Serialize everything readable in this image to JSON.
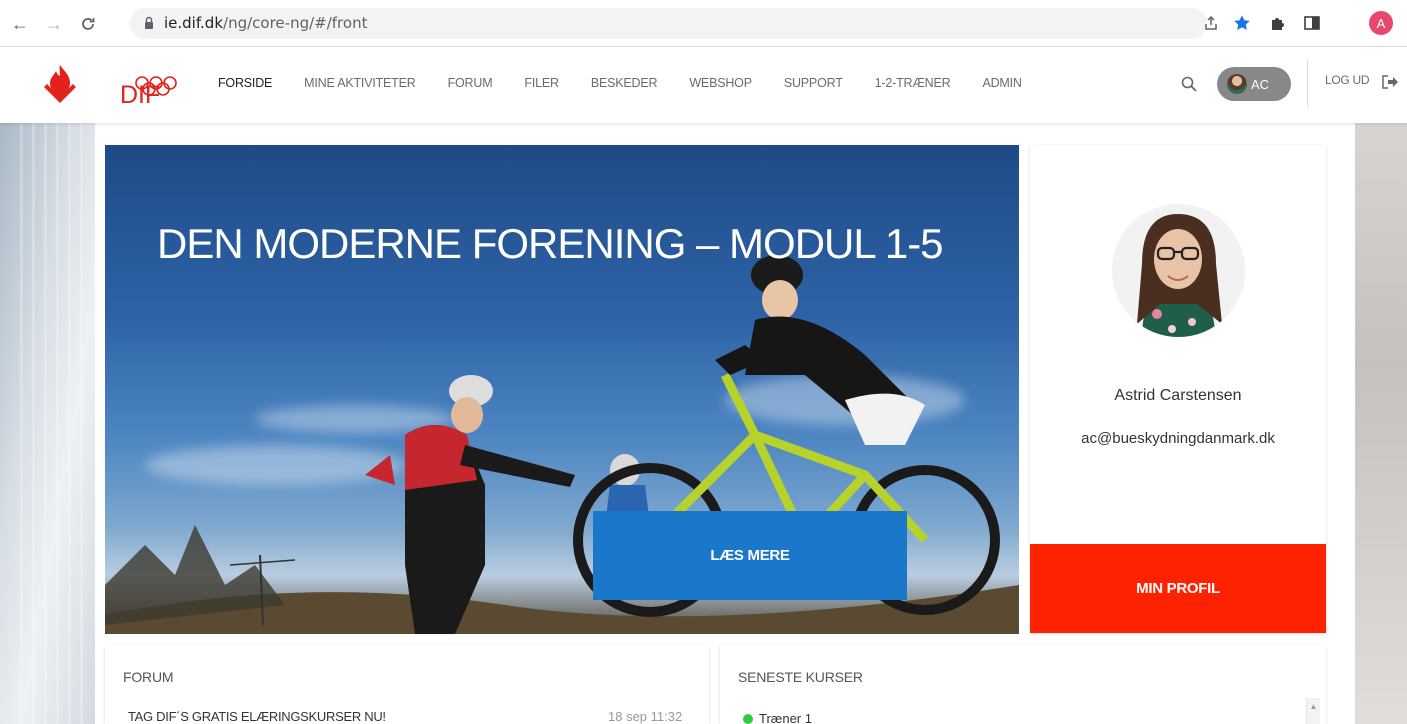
{
  "browser": {
    "url_domain": "ie.dif.dk",
    "url_path": "/ng/core-ng/#/front",
    "profile_initial": "A"
  },
  "header": {
    "logo_text": "DIF",
    "nav": [
      {
        "label": "FORSIDE",
        "active": true
      },
      {
        "label": "MINE AKTIVITETER"
      },
      {
        "label": "FORUM"
      },
      {
        "label": "FILER"
      },
      {
        "label": "BESKEDER"
      },
      {
        "label": "WEBSHOP"
      },
      {
        "label": "SUPPORT"
      },
      {
        "label": "1-2-TRÆNER"
      },
      {
        "label": "ADMIN"
      }
    ],
    "user_initials": "AC",
    "logout_label": "LOG UD"
  },
  "hero": {
    "title": "DEN MODERNE FORENING – MODUL 1-5",
    "button_label": "LÆS MERE"
  },
  "profile": {
    "name": "Astrid Carstensen",
    "email": "ac@bueskydningdanmark.dk",
    "button_label": "MIN PROFIL"
  },
  "forum": {
    "title": "FORUM",
    "posts": [
      {
        "title": "TAG DIF´S GRATIS ELÆRINGSKURSER NU!",
        "date": "18 sep 11:32"
      }
    ]
  },
  "courses": {
    "title": "SENESTE KURSER",
    "items": [
      {
        "label": "Træner 1"
      }
    ]
  },
  "colors": {
    "brand_red": "#e3221b",
    "hero_button": "#1b77c9",
    "profile_button": "#ff2200"
  }
}
